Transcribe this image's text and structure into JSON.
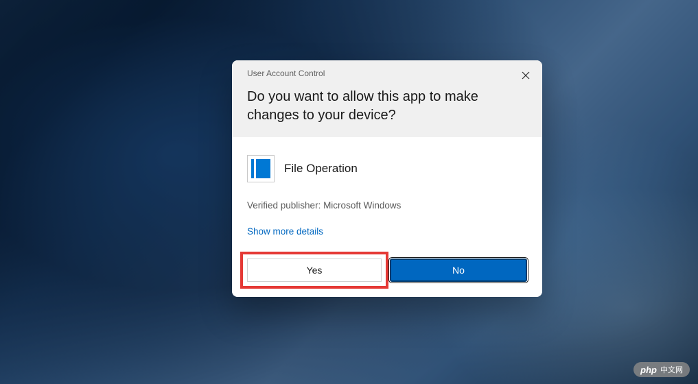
{
  "dialog": {
    "title": "User Account Control",
    "question": "Do you want to allow this app to make changes to your device?",
    "app_name": "File Operation",
    "publisher_label": "Verified publisher: Microsoft Windows",
    "details_link": "Show more details",
    "yes_label": "Yes",
    "no_label": "No"
  },
  "watermark": {
    "logo": "php",
    "text": "中文网"
  }
}
